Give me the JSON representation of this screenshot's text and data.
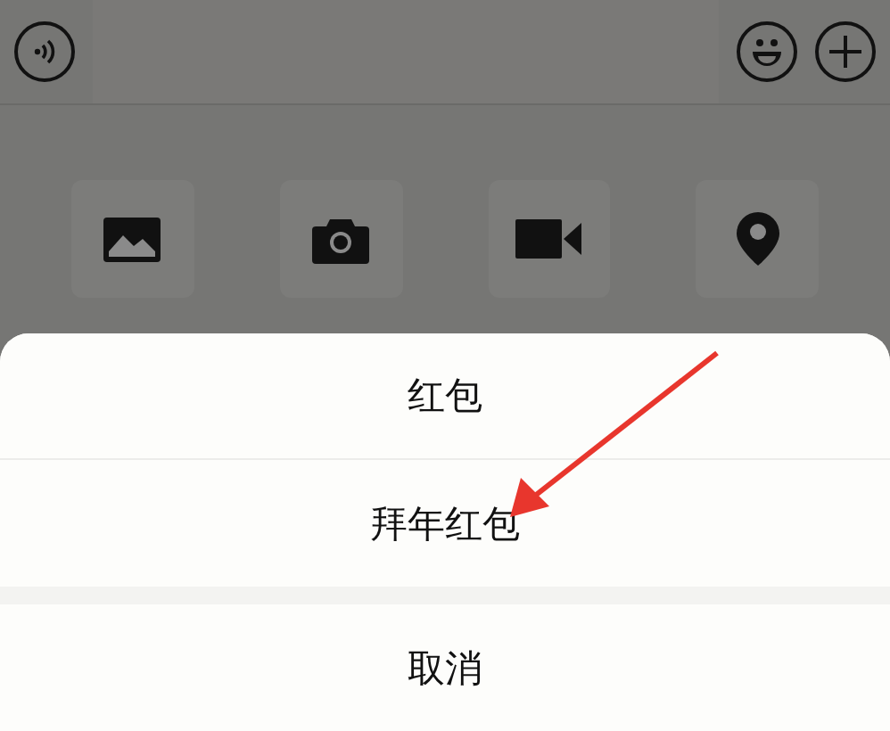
{
  "action_sheet": {
    "options": [
      {
        "label": "红包"
      },
      {
        "label": "拜年红包"
      }
    ],
    "cancel": "取消"
  }
}
